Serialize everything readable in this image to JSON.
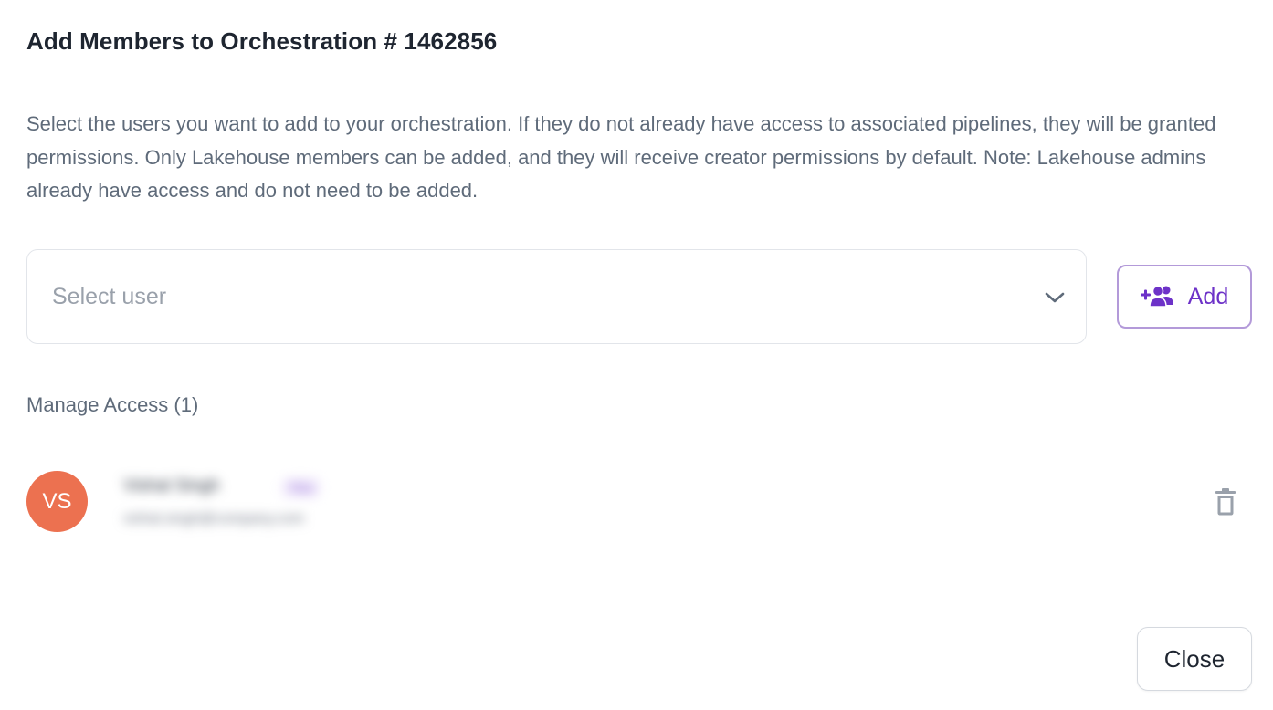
{
  "dialog": {
    "title": "Add Members to Orchestration # 1462856",
    "description": "Select the users you want to add to your orchestration. If they do not already have access to associated pipelines, they will be granted permissions. Only Lakehouse members can be added, and they will receive creator permissions by default. Note: Lakehouse admins already have access and do not need to be added."
  },
  "user_select": {
    "placeholder": "Select user",
    "icon": "chevron-down-icon"
  },
  "add_button": {
    "label": "Add",
    "icon": "add-group-icon",
    "color": "#6d32c8"
  },
  "manage_access": {
    "label": "Manage Access (1)",
    "members": [
      {
        "initials": "VS",
        "avatar_color": "#ec7150",
        "name": "Vishal Singh",
        "role": "You",
        "email": "vishal.singh@company.com"
      }
    ]
  },
  "close_button": {
    "label": "Close"
  }
}
